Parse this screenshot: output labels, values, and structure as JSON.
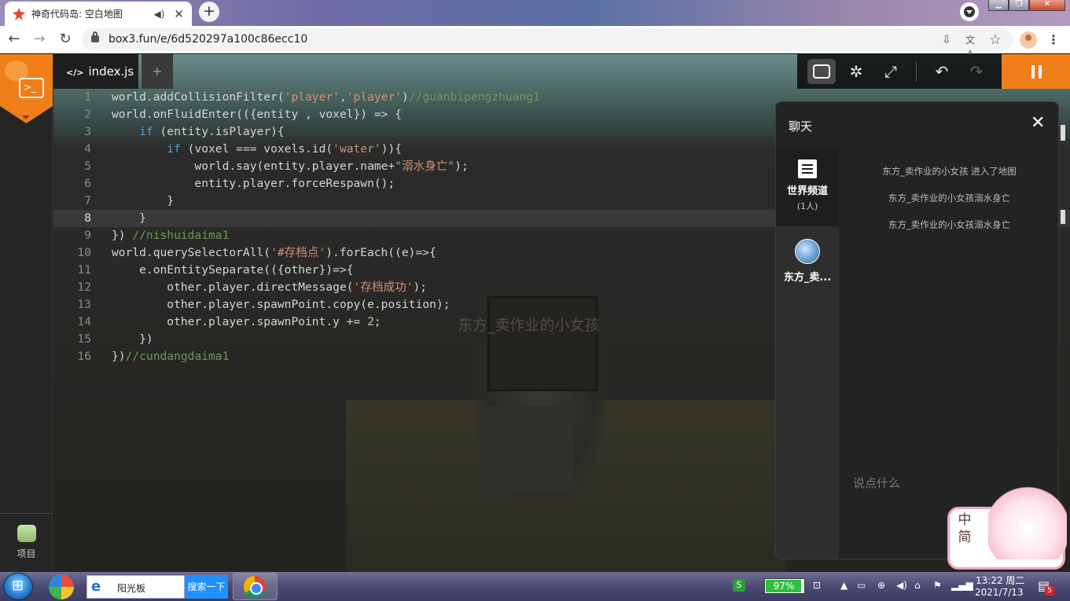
{
  "browser": {
    "tab_title": "神奇代码岛: 空白地图",
    "url": "box3.fun/e/6d520297a100c86ecc10"
  },
  "editor": {
    "file_tab": "index.js",
    "add_tab": "+",
    "lines": [
      {
        "n": "1",
        "html": "world.addCollisionFilter(<span class=\"str\">'player'</span>,<span class=\"str\">'player'</span>)<span class=\"cmt\">//guanbipengzhuang1</span>"
      },
      {
        "n": "2",
        "html": "world.onFluidEnter(({entity , voxel}) =&gt; {"
      },
      {
        "n": "3",
        "html": "    <span class=\"kw\">if</span> (entity.isPlayer){"
      },
      {
        "n": "4",
        "html": "        <span class=\"kw\">if</span> (voxel === voxels.id(<span class=\"str\">'water'</span>)){"
      },
      {
        "n": "5",
        "html": "            world.say(entity.player.name+<span class=\"str\">\"溺水身亡\"</span>);"
      },
      {
        "n": "6",
        "html": "            entity.player.forceRespawn();"
      },
      {
        "n": "7",
        "html": "        }"
      },
      {
        "n": "8",
        "html": "    }",
        "active": true
      },
      {
        "n": "9",
        "html": "}) <span class=\"cmt\">//nishuidaima1</span>"
      },
      {
        "n": "10",
        "html": "world.querySelectorAll(<span class=\"str\">'#存档点'</span>).forEach((e)=&gt;{"
      },
      {
        "n": "11",
        "html": "    e.onEntitySeparate(({other})=&gt;{"
      },
      {
        "n": "12",
        "html": "        other.player.directMessage(<span class=\"str\">'存档成功'</span>);"
      },
      {
        "n": "13",
        "html": "        other.player.spawnPoint.copy(e.position);"
      },
      {
        "n": "14",
        "html": "        other.player.spawnPoint.y += <span class=\"num\">2</span>;"
      },
      {
        "n": "15",
        "html": "    })"
      },
      {
        "n": "16",
        "html": "})<span class=\"cmt\">//cundangdaima1</span>"
      }
    ]
  },
  "sidebar": {
    "project_label": "项目"
  },
  "scene": {
    "player_label": "东方_卖作业的小女孩"
  },
  "chat": {
    "title": "聊天",
    "close": "✕",
    "world_channel": "世界频道",
    "world_count": "(1人)",
    "user_channel": "东方_卖...",
    "messages": [
      "东方_卖作业的小女孩 进入了地图",
      "东方_卖作业的小女孩溺水身亡",
      "东方_卖作业的小女孩溺水身亡"
    ],
    "input_placeholder": "说点什么"
  },
  "ime": {
    "mode_line1": "中",
    "mode_line2": "简"
  },
  "taskbar": {
    "ie_label": "阳光板",
    "search_label": "搜索一下",
    "battery": "97%",
    "battery_level": 0.97,
    "time": "13:22 周二",
    "date": "2021/7/13",
    "notif_count": "5"
  },
  "colors": {
    "accent": "#f07f1a",
    "string": "#ce9178",
    "comment": "#6a9955",
    "keyword": "#569cd6"
  }
}
